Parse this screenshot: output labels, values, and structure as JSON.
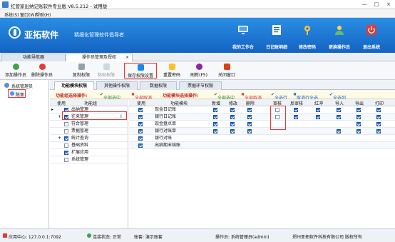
{
  "window": {
    "title": "红管家出纳记账软件专业版 V8.5.212 - 试用版",
    "controls": [
      "—",
      "□",
      "×"
    ]
  },
  "menu": [
    "系统(S)",
    "窗口(W)",
    "帮助(H)"
  ],
  "header": {
    "brand": "亚拓软件",
    "slogan": "精细化管理软件倡导者",
    "buttons": [
      {
        "label": "我的工作台",
        "icon": "monitor-icon"
      },
      {
        "label": "日记账明细",
        "icon": "ledger-icon"
      },
      {
        "label": "修改密码",
        "icon": "key-icon"
      },
      {
        "label": "更换操作员",
        "icon": "user-swap-icon"
      },
      {
        "label": "退出系统",
        "icon": "power-icon"
      }
    ]
  },
  "tabs": [
    {
      "label": "功能导航器",
      "active": false
    },
    {
      "label": "操作员管理及授权",
      "active": true,
      "close": "×"
    }
  ],
  "toolbar": [
    {
      "label": "添加操作员",
      "icon": "add-user-icon",
      "enabled": true
    },
    {
      "label": "删除操作员",
      "icon": "delete-user-icon",
      "enabled": true
    },
    {
      "label": "复制权限",
      "icon": "copy-icon",
      "enabled": true
    },
    {
      "label": "粘贴权限",
      "icon": "paste-icon",
      "enabled": false
    },
    {
      "label": "保存权限设置",
      "icon": "save-icon",
      "enabled": true,
      "highlighted": true
    },
    {
      "label": "重置密码",
      "icon": "reset-password-icon",
      "enabled": true
    },
    {
      "label": "刷新(F5)",
      "icon": "refresh-icon",
      "enabled": true
    },
    {
      "label": "关闭窗口",
      "icon": "close-window-icon",
      "enabled": true
    }
  ],
  "tree": [
    {
      "label": "系统管理员",
      "selected": false
    },
    {
      "label": "陈亚",
      "selected": true
    }
  ],
  "subtabs": [
    {
      "label": "功能模块权限",
      "active": true
    },
    {
      "label": "其他操作权限",
      "active": false
    },
    {
      "label": "数据权限",
      "active": false
    },
    {
      "label": "票据环节权限",
      "active": false
    }
  ],
  "ops": {
    "group_title": "功能组选择操作:",
    "group_select_all": "全部选中",
    "group_cancel_all": "全部取消",
    "module_title": "功能模块选择操作:",
    "module_select_all": "全部选中",
    "module_cancel_all": "全部取消",
    "select_row": "全选行",
    "cancel_row": "取消行全选",
    "select_col": "全选列"
  },
  "group_table": {
    "headers": [
      "使用",
      "功能组"
    ],
    "rows": [
      {
        "label": "出纳管理",
        "checked": true,
        "current": true,
        "highlighted": true
      },
      {
        "label": "往来管理",
        "checked": true,
        "expand": "+"
      },
      {
        "label": "符合管理",
        "checked": false
      },
      {
        "label": "票据管理",
        "checked": false
      },
      {
        "label": "统计查询",
        "checked": true,
        "expand": "+"
      },
      {
        "label": "基础资料",
        "checked": false
      },
      {
        "label": "扩展应用",
        "checked": true
      },
      {
        "label": "系统管理",
        "checked": false
      }
    ]
  },
  "module_table": {
    "headers": [
      "使用",
      "功能模块",
      "新增",
      "修改",
      "删除",
      "审核",
      "反审核",
      "红冲",
      "导入",
      "导出",
      "打印"
    ],
    "rows": [
      {
        "module": "现金日记账",
        "use": true,
        "perms": [
          true,
          true,
          true,
          false,
          true,
          true,
          true,
          true,
          true
        ]
      },
      {
        "module": "银行日记账",
        "use": true,
        "cursor": "I",
        "perms": [
          true,
          true,
          true,
          false,
          true,
          true,
          true,
          true,
          true
        ]
      },
      {
        "module": "现金盘点单",
        "use": true,
        "perms": [
          true,
          true,
          true,
          null,
          null,
          null,
          null,
          true,
          true
        ]
      },
      {
        "module": "银行对账单",
        "use": true,
        "perms": [
          true,
          true,
          true,
          null,
          null,
          null,
          true,
          true,
          true
        ]
      },
      {
        "module": "银行对账",
        "use": true,
        "perms": [
          null,
          null,
          null,
          null,
          null,
          null,
          null,
          null,
          null
        ]
      },
      {
        "module": "出纳期末结账",
        "use": true,
        "perms": [
          null,
          null,
          null,
          null,
          null,
          null,
          null,
          null,
          null
        ]
      }
    ]
  },
  "status": {
    "app_center": "应用中心: 127.0.0.1:7092",
    "connection": "连接状态: 正常",
    "ledger": "账套: 演示账套",
    "operator": "操作员: 系统管理员(admin)",
    "company": "郑州亚拓软件科技有限公司 版权所有"
  }
}
